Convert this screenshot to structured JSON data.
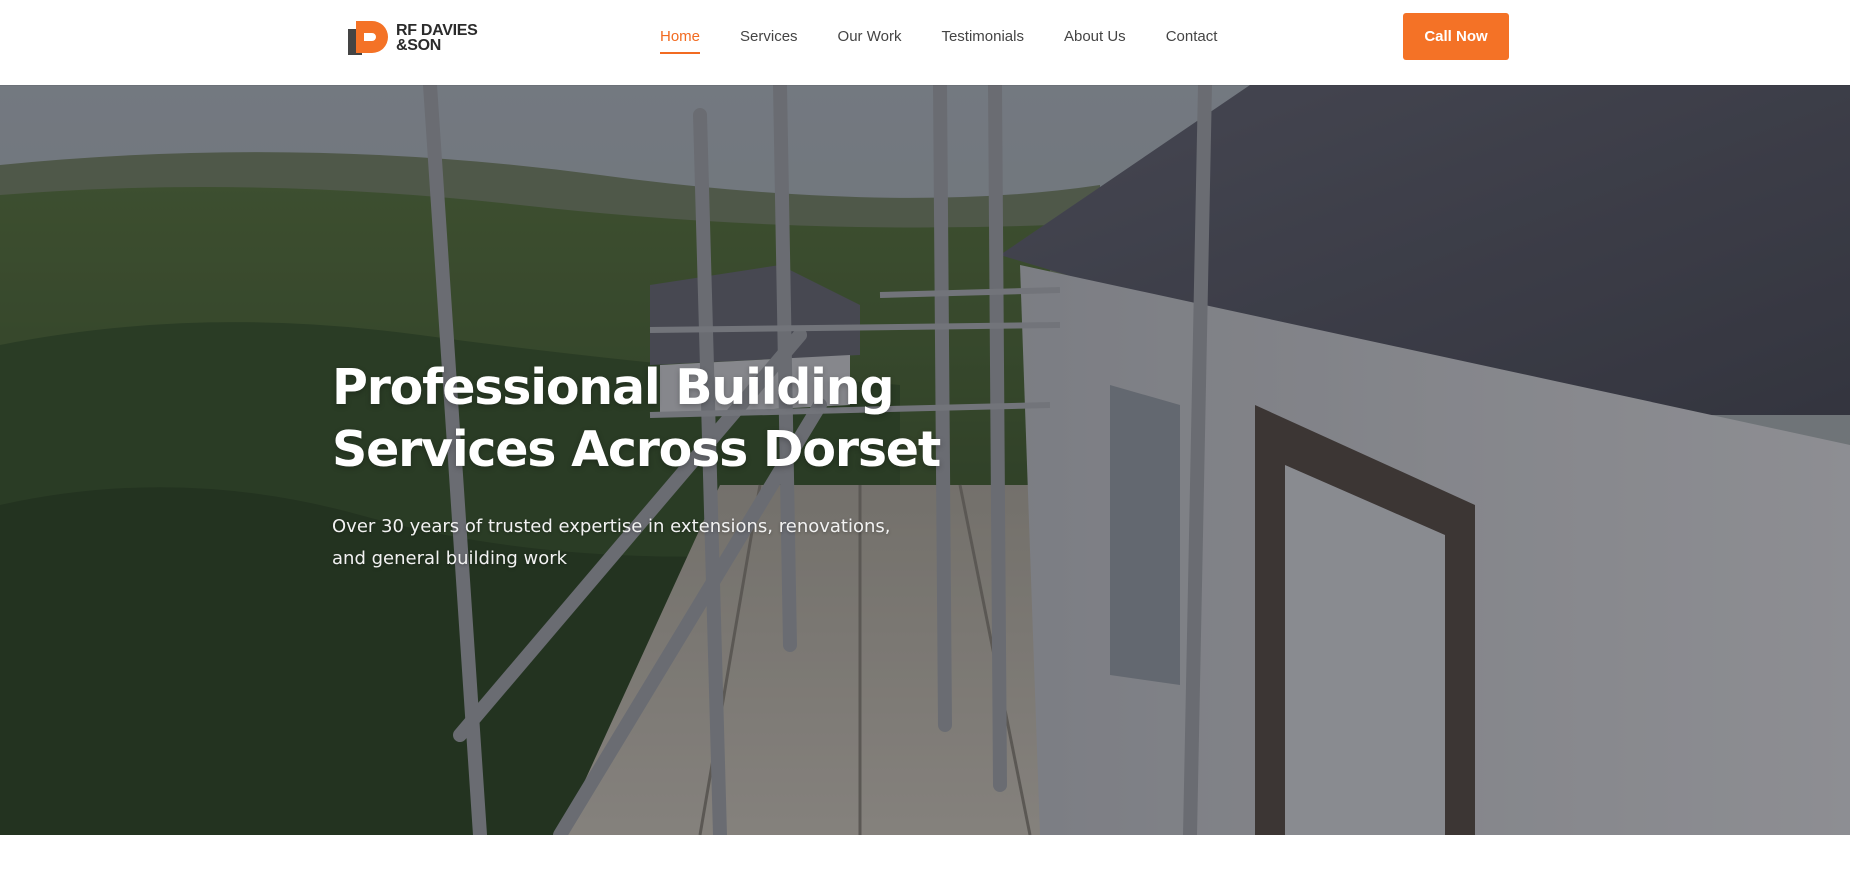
{
  "header": {
    "logo": {
      "line1": "RF DAVIES",
      "line2": "&SON"
    },
    "nav": [
      {
        "label": "Home",
        "active": true
      },
      {
        "label": "Services",
        "active": false
      },
      {
        "label": "Our Work",
        "active": false
      },
      {
        "label": "Testimonials",
        "active": false
      },
      {
        "label": "About Us",
        "active": false
      },
      {
        "label": "Contact",
        "active": false
      }
    ],
    "cta_label": "Call Now"
  },
  "hero": {
    "title": "Professional Building Services Across Dorset",
    "subtitle": "Over 30 years of trusted expertise in extensions, renovations, and general building work"
  },
  "colors": {
    "accent": "#f47226",
    "nav_active": "#f26b21",
    "logo_dark": "#3a3a3a",
    "hero_text": "#ffffff"
  }
}
